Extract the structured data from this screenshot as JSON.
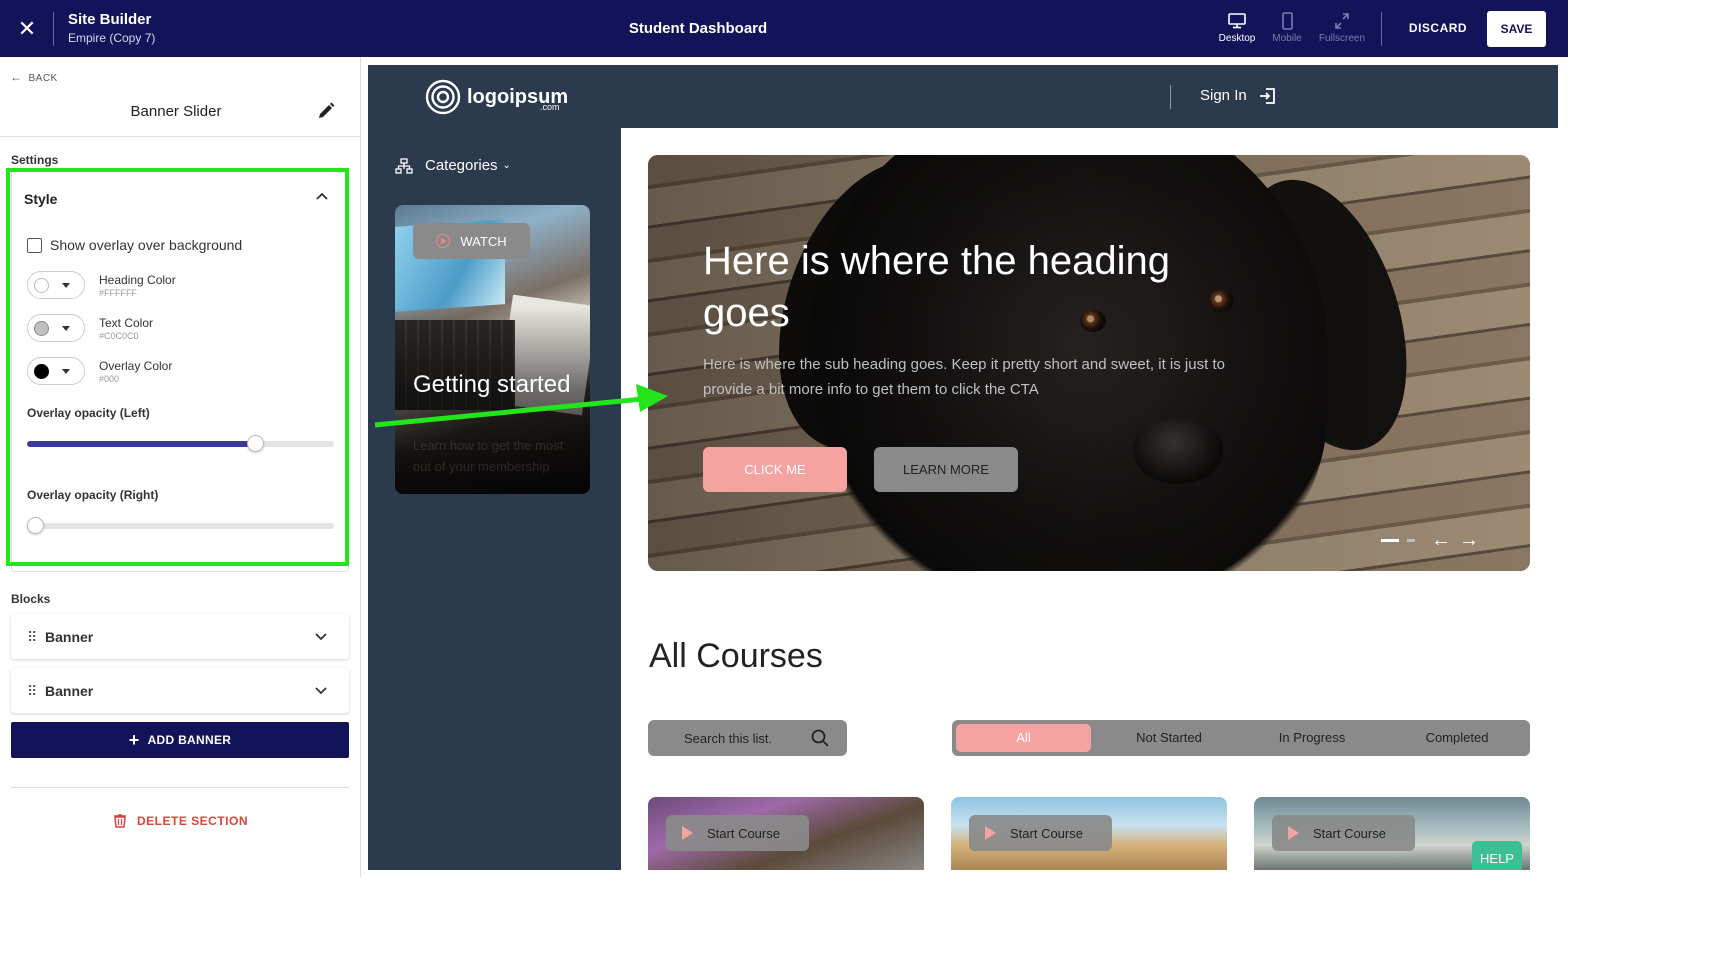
{
  "topbar": {
    "app_title": "Site Builder",
    "app_subtitle": "Empire (Copy 7)",
    "page_name": "Student Dashboard",
    "views": [
      {
        "label": "Desktop",
        "icon": "desktop-icon",
        "active": true
      },
      {
        "label": "Mobile",
        "icon": "mobile-icon",
        "active": false
      },
      {
        "label": "Fullscreen",
        "icon": "fullscreen-icon",
        "active": false
      }
    ],
    "discard_label": "DISCARD",
    "save_label": "SAVE",
    "colors": {
      "bar": "#13135a"
    }
  },
  "sidebar": {
    "back_label": "BACK",
    "panel_title": "Banner Slider",
    "settings_label": "Settings",
    "style": {
      "header": "Style",
      "overlay_checkbox_label": "Show overlay over background",
      "overlay_checked": false,
      "colors": [
        {
          "label": "Heading Color",
          "value": "#FFFFFF"
        },
        {
          "label": "Text Color",
          "value": "#C0C0C0"
        },
        {
          "label": "Overlay Color",
          "value": "#000"
        }
      ],
      "overlay_left_label": "Overlay opacity (Left)",
      "overlay_left_value": 0.76,
      "overlay_right_label": "Overlay opacity (Right)",
      "overlay_right_value": 0.0
    },
    "blocks_label": "Blocks",
    "blocks": [
      {
        "label": "Banner"
      },
      {
        "label": "Banner"
      }
    ],
    "add_banner_label": "ADD BANNER",
    "delete_section_label": "DELETE SECTION"
  },
  "preview": {
    "logo_text": "logoipsum",
    "logo_suffix": ".com",
    "sign_in_label": "Sign In",
    "categories_label": "Categories",
    "video_card": {
      "watch_label": "WATCH",
      "title": "Getting started",
      "description": "Learn how to get the most out of your membership"
    },
    "hero": {
      "heading": "Here is where the heading goes",
      "subheading": "Here is where the sub heading goes. Keep it pretty short and sweet, it is just to provide a bit more info to get them to click the CTA",
      "primary_cta": "CLICK ME",
      "secondary_cta": "LEARN MORE",
      "slide_count": 2,
      "active_slide": 1
    },
    "courses": {
      "title": "All Courses",
      "search_placeholder": "Search this list.",
      "filters": [
        {
          "label": "All",
          "active": true
        },
        {
          "label": "Not Started",
          "active": false
        },
        {
          "label": "In Progress",
          "active": false
        },
        {
          "label": "Completed",
          "active": false
        }
      ],
      "cards": [
        {
          "button": "Start Course"
        },
        {
          "button": "Start Course"
        },
        {
          "button": "Start Course"
        }
      ]
    },
    "help_label": "HELP",
    "colors": {
      "nav": "#2b3a4d",
      "accent": "#f5a3a0",
      "help": "#3cbf95"
    }
  },
  "annotation": {
    "color": "#22e51a"
  }
}
